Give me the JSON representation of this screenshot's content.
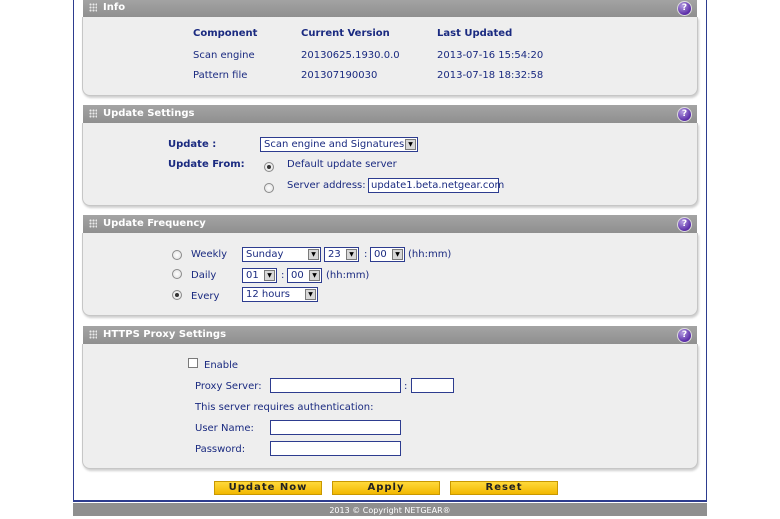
{
  "info": {
    "title": "Info",
    "headers": [
      "Component",
      "Current Version",
      "Last Updated"
    ],
    "rows": [
      [
        "Scan engine",
        "20130625.1930.0.0",
        "2013-07-16 15:54:20"
      ],
      [
        "Pattern file",
        "201307190030",
        "2013-07-18 18:32:58"
      ]
    ]
  },
  "update_settings": {
    "title": "Update Settings",
    "update_label": "Update :",
    "update_value": "Scan engine and Signatures",
    "from_label": "Update From:",
    "default_server_label": "Default update server",
    "server_address_label": "Server address:",
    "server_address_value": "update1.beta.netgear.com",
    "selected_source": "default"
  },
  "update_frequency": {
    "title": "Update Frequency",
    "weekly_label": "Weekly",
    "weekly_day": "Sunday",
    "weekly_hour": "23",
    "weekly_minute": "00",
    "daily_label": "Daily",
    "daily_hour": "01",
    "daily_minute": "00",
    "every_label": "Every",
    "every_value": "12 hours",
    "hhmm_label": "(hh:mm)",
    "colon": ":",
    "selected": "every"
  },
  "https_proxy": {
    "title": "HTTPS Proxy Settings",
    "enable_label": "Enable",
    "proxy_server_label": "Proxy Server:",
    "proxy_server_value": "",
    "proxy_port_value": "",
    "auth_text": "This server requires authentication:",
    "username_label": "User Name:",
    "username_value": "",
    "password_label": "Password:",
    "password_value": ""
  },
  "buttons": {
    "update_now": "Update Now",
    "apply": "Apply",
    "reset": "Reset"
  },
  "footer": "2013 © Copyright NETGEAR®",
  "icons": {
    "help": "help-icon",
    "grip": "grip-icon",
    "dropdown": "chevron-down-icon"
  }
}
